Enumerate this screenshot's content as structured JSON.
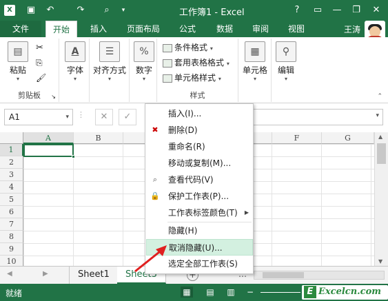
{
  "titlebar": {
    "title": "工作簿1 - Excel",
    "app_badge": "X",
    "help": "?",
    "ribbon_display": "▭",
    "minimize": "—",
    "restore": "❐",
    "close": "✕",
    "save_icon": "save-icon",
    "undo": "↶",
    "redo": "↷",
    "preview": "⌕",
    "customize": "▾"
  },
  "tabs": {
    "file": "文件",
    "home": "开始",
    "insert": "插入",
    "layout": "页面布局",
    "formulas": "公式",
    "data": "数据",
    "review": "审阅",
    "view": "视图",
    "user": "王涛"
  },
  "ribbon": {
    "paste": "粘贴",
    "clipboard": "剪贴板",
    "font": "字体",
    "align": "对齐方式",
    "number": "数字",
    "cond_format": "条件格式",
    "table_format": "套用表格格式",
    "cell_style": "单元格样式",
    "styles": "样式",
    "cells": "单元格",
    "editing": "编辑",
    "font_icon_glyph": "A",
    "number_icon_glyph": "%"
  },
  "formula": {
    "namebox": "A1",
    "cancel": "✕",
    "enter": "✓"
  },
  "grid": {
    "columns": [
      "A",
      "B",
      "C",
      "D",
      "E",
      "F",
      "G"
    ],
    "rows": [
      "1",
      "2",
      "3",
      "4",
      "5",
      "6",
      "7",
      "8",
      "9",
      "10"
    ]
  },
  "sheets": {
    "tabs": [
      "Sheet1",
      "Sheet3"
    ],
    "add": "+",
    "ellipsis": "…"
  },
  "status": {
    "text": "就绪",
    "watermark": "Excelcn.com",
    "watermark_e": "E"
  },
  "context_menu": {
    "items": [
      "插入(I)...",
      "删除(D)",
      "重命名(R)",
      "移动或复制(M)...",
      "查看代码(V)",
      "保护工作表(P)...",
      "工作表标签颜色(T)",
      "隐藏(H)",
      "取消隐藏(U)...",
      "选定全部工作表(S)"
    ]
  }
}
